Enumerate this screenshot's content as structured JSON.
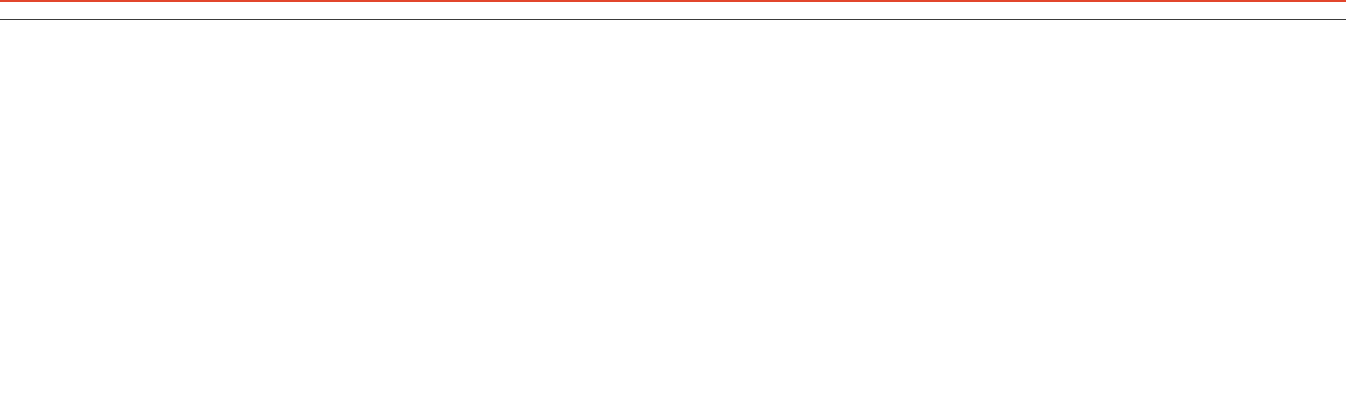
{
  "colors": {
    "accent": "#e2462c",
    "divider": "#3a3a3a",
    "background": "#ffffff"
  }
}
